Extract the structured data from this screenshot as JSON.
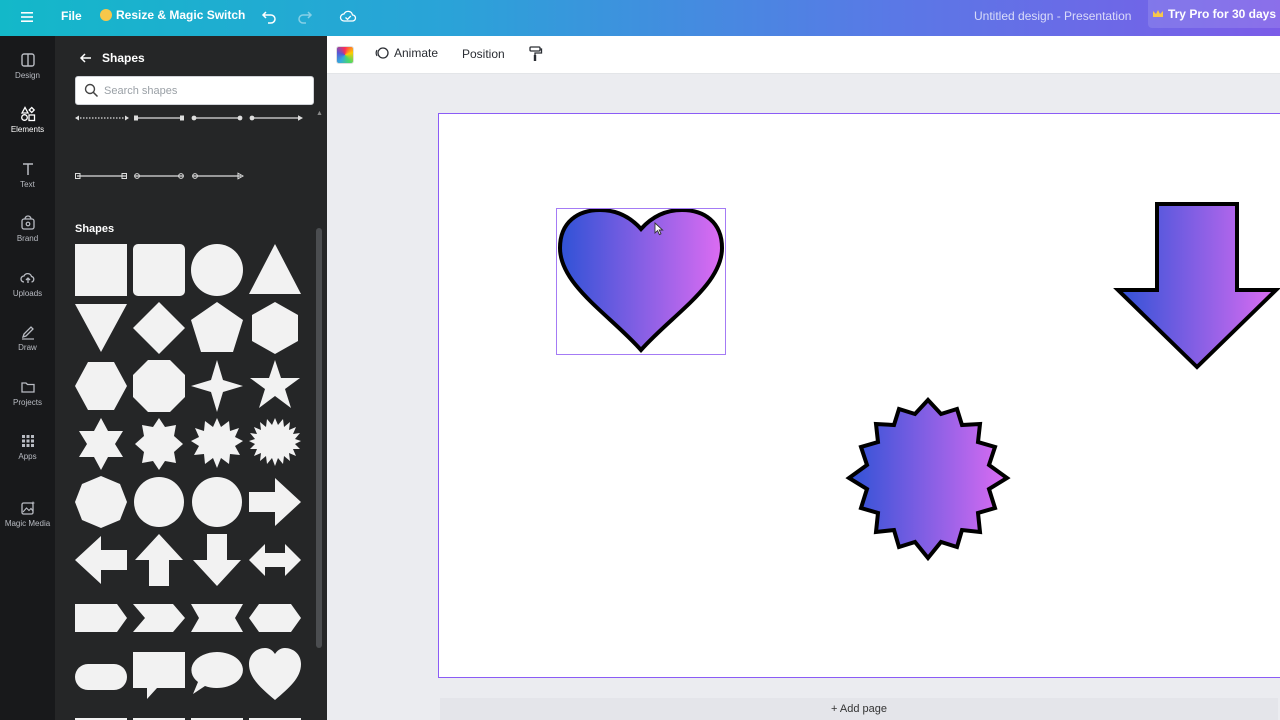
{
  "topbar": {
    "file_label": "File",
    "resize_label": "Resize & Magic Switch",
    "doc_title": "Untitled design - Presentation",
    "pro_label": "Try Pro for 30 days",
    "icons": [
      "menu-icon",
      "crown-icon",
      "undo-icon",
      "redo-icon",
      "cloud-saved-icon"
    ]
  },
  "rail": {
    "items": [
      {
        "label": "Design",
        "icon": "design-icon"
      },
      {
        "label": "Elements",
        "icon": "elements-icon",
        "active": true
      },
      {
        "label": "Text",
        "icon": "text-icon"
      },
      {
        "label": "Brand",
        "icon": "brand-icon"
      },
      {
        "label": "Uploads",
        "icon": "uploads-icon"
      },
      {
        "label": "Draw",
        "icon": "draw-icon"
      },
      {
        "label": "Projects",
        "icon": "projects-icon"
      },
      {
        "label": "Apps",
        "icon": "apps-icon"
      },
      {
        "label": "Magic Media",
        "icon": "magic-media-icon"
      }
    ]
  },
  "panel": {
    "title": "Shapes",
    "search_placeholder": "Search shapes",
    "section_label": "Shapes",
    "shapes": [
      "square",
      "rounded-square",
      "circle",
      "triangle",
      "inverted-triangle",
      "diamond",
      "pentagon",
      "hexagon",
      "hexagon-flat",
      "octagon",
      "four-point-star",
      "five-point-star",
      "six-point-star",
      "eight-point-star",
      "burst-12",
      "burst-16",
      "heptagon",
      "circle-scalloped",
      "circle-wavy",
      "arrow-right",
      "arrow-left",
      "arrow-up",
      "arrow-down",
      "arrow-left-right",
      "tag-pentagon",
      "chevron",
      "ribbon",
      "elongated-hexagon",
      "pill",
      "speech-bubble-rect",
      "speech-bubble-round",
      "heart"
    ]
  },
  "toolbar": {
    "animate_label": "Animate",
    "position_label": "Position"
  },
  "canvas": {
    "add_page_label": "+ Add page",
    "gradient_start": "#2f52d6",
    "gradient_end": "#dc6cf2",
    "selection_color": "#8b5cf6"
  }
}
